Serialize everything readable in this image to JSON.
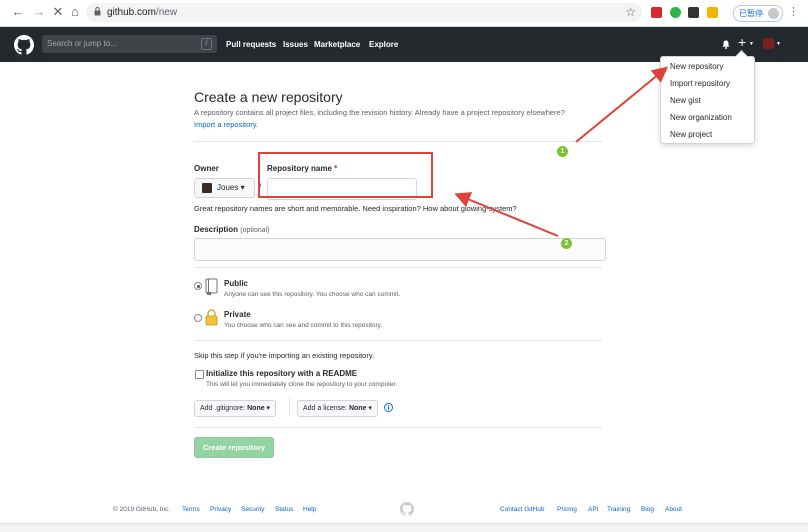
{
  "browser": {
    "url_host": "github.com",
    "url_path": "/new",
    "profile_chip_text": "已暂停"
  },
  "header": {
    "search_placeholder": "Search or jump to...",
    "search_shortcut": "/",
    "nav": [
      "Pull requests",
      "Issues",
      "Marketplace",
      "Explore"
    ],
    "plus": "+"
  },
  "dropdown": {
    "items": [
      "New repository",
      "Import repository",
      "New gist",
      "New organization",
      "New project"
    ]
  },
  "main": {
    "title": "Create a new repository",
    "subtitle": "A repository contains all project files, including the revision history. Already have a project repository elsewhere?",
    "import_link": "Import a repository.",
    "owner_label": "Owner",
    "owner_value": "Joues ▾",
    "repo_label": "Repository name",
    "required_mark": "*",
    "separator": "/",
    "hint": "Great repository names are short and memorable. Need inspiration? How about glowing-system?",
    "description_label": "Description",
    "description_optional": "(optional)",
    "public_title": "Public",
    "public_desc": "Anyone can see this repository. You choose who can commit.",
    "private_title": "Private",
    "private_desc": "You choose who can see and commit to this repository.",
    "skip_text": "Skip this step if you're importing an existing repository.",
    "readme_label": "Initialize this repository with a README",
    "readme_desc": "This will let you immediately clone the repository to your computer.",
    "gitignore_prefix": "Add .gitignore:",
    "gitignore_value": "None ▾",
    "license_prefix": "Add a license:",
    "license_value": "None ▾",
    "create_button": "Create repository"
  },
  "footer": {
    "copyright": "© 2019 GitHub, Inc.",
    "left_links": [
      "Terms",
      "Privacy",
      "Security",
      "Status",
      "Help"
    ],
    "right_links": [
      "Contact GitHub",
      "Pricing",
      "API",
      "Training",
      "Blog",
      "About"
    ]
  },
  "annotations": {
    "badge_1": "1",
    "badge_2": "2",
    "color": "#e0413a",
    "badge_color": "#7cc231"
  }
}
